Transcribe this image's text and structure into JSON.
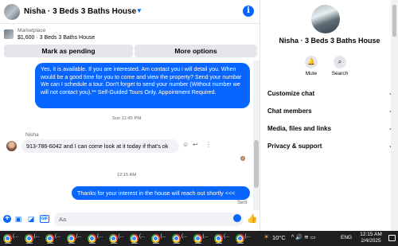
{
  "chat": {
    "title": "Nisha · 3 Beds 3 Baths House",
    "info_icon": "info-icon",
    "listing": {
      "source": "Marketplace",
      "detail": "$1,600 · 3 Beds 3 Baths House"
    },
    "actions": {
      "mark_pending": "Mark as pending",
      "more_options": "More options"
    },
    "messages": {
      "outgoing_1": "Yes, it is available. If you are interested.  Am contact you i will detail you. When would be a good time for you to come and view the property? Send your numbar We can I schedule a tour.  Don't forget to send your number (Without number we will not contact you).** Self-Guided Tours Only. Appointment Required.",
      "timestamp_1": "Sun 11:45 PM",
      "sender_name": "Nisha",
      "incoming_1": "913-786-6042 and I can come look at it today if that's ok",
      "timestamp_2": "12:15 AM",
      "outgoing_2": "Thanks for your interest in the house will reach out shortly  <<<",
      "status": "Sent"
    },
    "composer": {
      "placeholder": "Aa"
    }
  },
  "info_pane": {
    "name": "Nisha · 3 Beds 3 Baths House",
    "buttons": {
      "mute": "Mute",
      "search": "Search"
    },
    "sections": [
      "Customize chat",
      "Chat members",
      "Media, files and links",
      "Privacy & support"
    ]
  },
  "taskbar": {
    "app_label": "(...",
    "app_count": 12,
    "weather": "10°C",
    "language": "ENG",
    "time": "12:15 AM",
    "date": "2/4/2025"
  },
  "colors": {
    "accent": "#0866ff",
    "bubble_incoming": "#f0f2f5",
    "taskbar": "#1f1f1f"
  }
}
